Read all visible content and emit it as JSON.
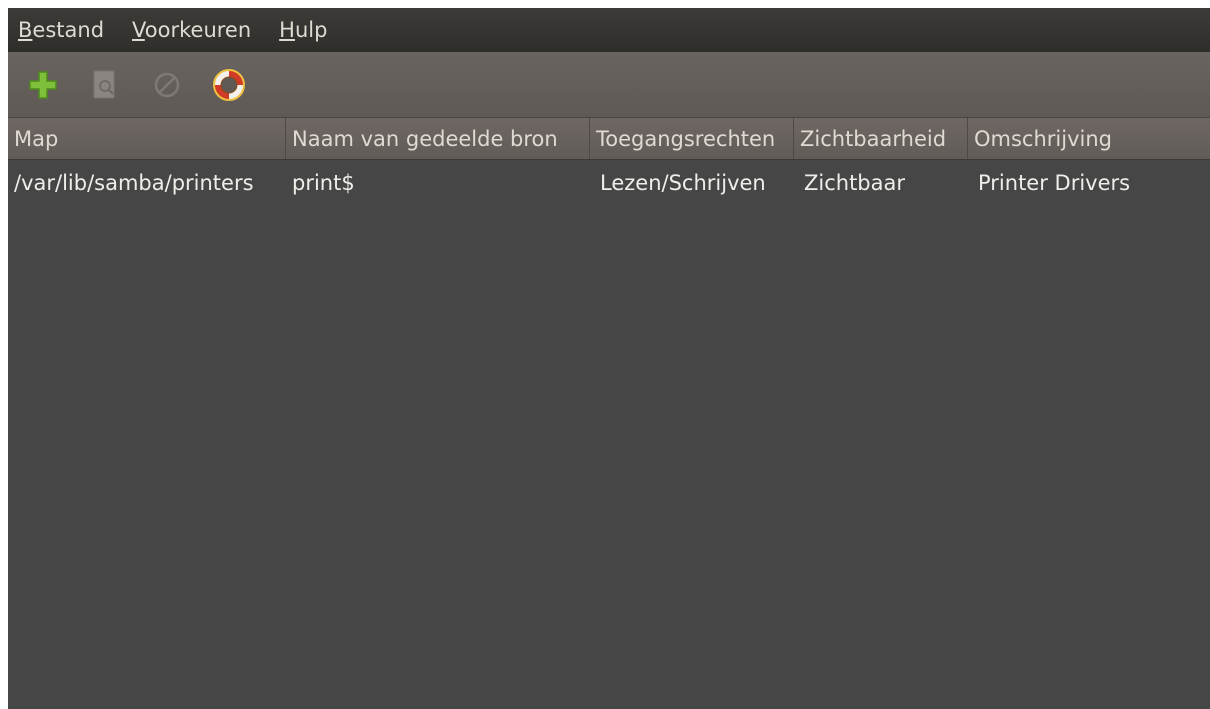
{
  "menubar": {
    "items": [
      {
        "accel": "B",
        "rest": "estand"
      },
      {
        "accel": "V",
        "rest": "oorkeuren"
      },
      {
        "accel": "H",
        "rest": "ulp"
      }
    ]
  },
  "toolbar": {
    "buttons": [
      {
        "icon": "add-icon",
        "enabled": true
      },
      {
        "icon": "properties-icon",
        "enabled": false
      },
      {
        "icon": "delete-icon",
        "enabled": false
      },
      {
        "icon": "help-lifebuoy-icon",
        "enabled": true
      }
    ]
  },
  "table": {
    "columns": [
      "Map",
      "Naam van gedeelde bron",
      "Toegangsrechten",
      "Zichtbaarheid",
      "Omschrijving"
    ],
    "rows": [
      [
        "/var/lib/samba/printers",
        "print$",
        "Lezen/Schrijven",
        "Zichtbaar",
        "Printer Drivers"
      ]
    ]
  },
  "colors": {
    "background": "#464646",
    "menubar": "#3c3b37",
    "toolbar": "#6a6460",
    "header": "#6e6763",
    "add_icon": "#73b52b",
    "lifebuoy_red": "#d23a28"
  }
}
